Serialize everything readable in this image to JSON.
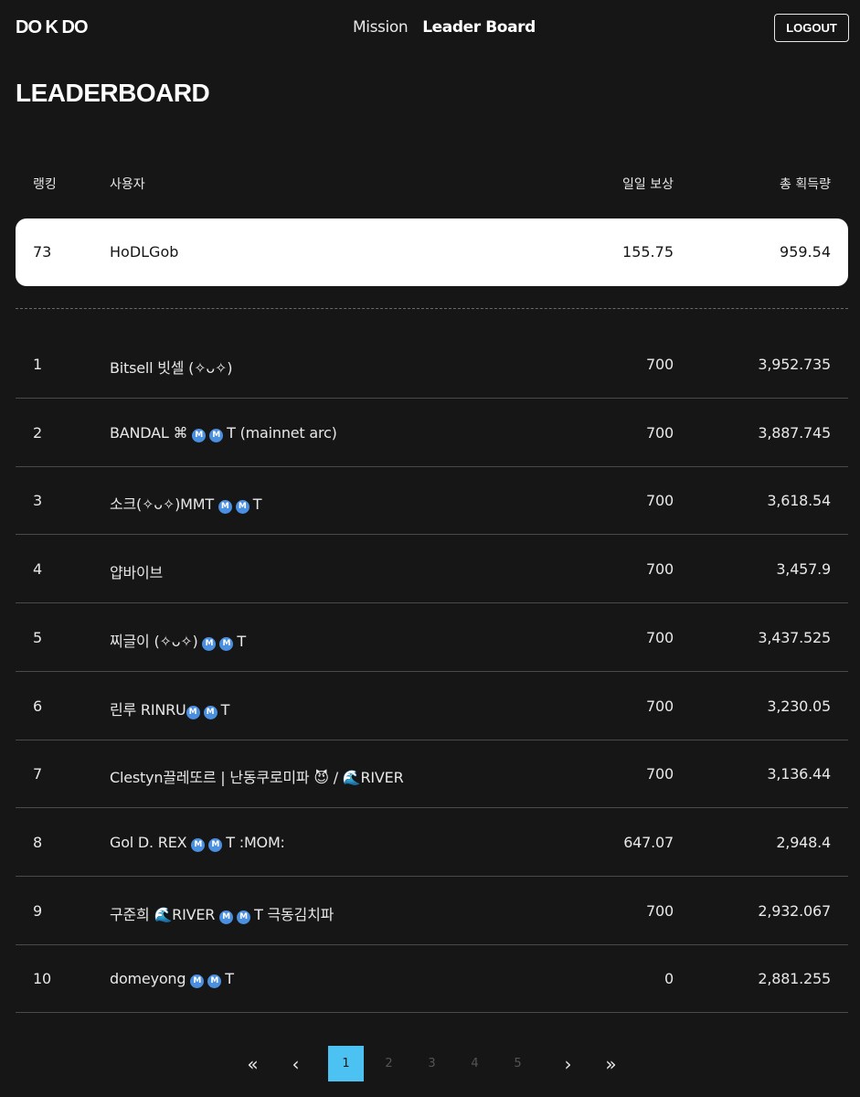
{
  "header": {
    "logo": "DO K DO",
    "nav": {
      "mission": "Mission",
      "leaderboard": "Leader Board"
    },
    "logout": "LOGOUT"
  },
  "page_title": "LEADERBOARD",
  "columns": {
    "rank": "랭킹",
    "user": "사용자",
    "daily": "일일 보상",
    "total": "총 획득량"
  },
  "me": {
    "rank": "73",
    "user": "HoDLGob",
    "daily": "155.75",
    "total": "959.54"
  },
  "rows": [
    {
      "rank": "1",
      "pre": "Bitsell 빗셀 (✧ᴗ✧)",
      "badges": 0,
      "post": "",
      "daily": "700",
      "total": "3,952.735"
    },
    {
      "rank": "2",
      "pre": "BANDAL ⌘ ",
      "badges": 2,
      "post": "T (mainnet arc)",
      "daily": "700",
      "total": "3,887.745"
    },
    {
      "rank": "3",
      "pre": "소크(✧ᴗ✧)MMT ",
      "badges": 2,
      "post": "T",
      "daily": "700",
      "total": "3,618.54"
    },
    {
      "rank": "4",
      "pre": "얍바이브",
      "badges": 0,
      "post": "",
      "daily": "700",
      "total": "3,457.9"
    },
    {
      "rank": "5",
      "pre": "찌글이 (✧ᴗ✧) ",
      "badges": 2,
      "post": "T",
      "daily": "700",
      "total": "3,437.525"
    },
    {
      "rank": "6",
      "pre": "린루 RINRU",
      "badges": 2,
      "post": "T",
      "daily": "700",
      "total": "3,230.05"
    },
    {
      "rank": "7",
      "pre": "Clestyn끌레또르 | 난동쿠로미파 😈 / 🌊RIVER",
      "badges": 0,
      "post": "",
      "daily": "700",
      "total": "3,136.44"
    },
    {
      "rank": "8",
      "pre": "Gol D. REX ",
      "badges": 2,
      "post": "T :MOM:",
      "daily": "647.07",
      "total": "2,948.4"
    },
    {
      "rank": "9",
      "pre": "구준희 🌊RIVER ",
      "badges": 2,
      "post": "T 극동김치파",
      "daily": "700",
      "total": "2,932.067"
    },
    {
      "rank": "10",
      "pre": "domeyong ",
      "badges": 2,
      "post": "T",
      "daily": "0",
      "total": "2,881.255"
    }
  ],
  "badge_letter": "M",
  "pagination": {
    "first": "«",
    "prev": "‹",
    "next": "›",
    "last": "»",
    "pages": [
      "1",
      "2",
      "3",
      "4",
      "5"
    ],
    "current": "1"
  },
  "colors": {
    "background": "#161616",
    "accent": "#4cc2f2",
    "badge": "#4a8fe0"
  }
}
